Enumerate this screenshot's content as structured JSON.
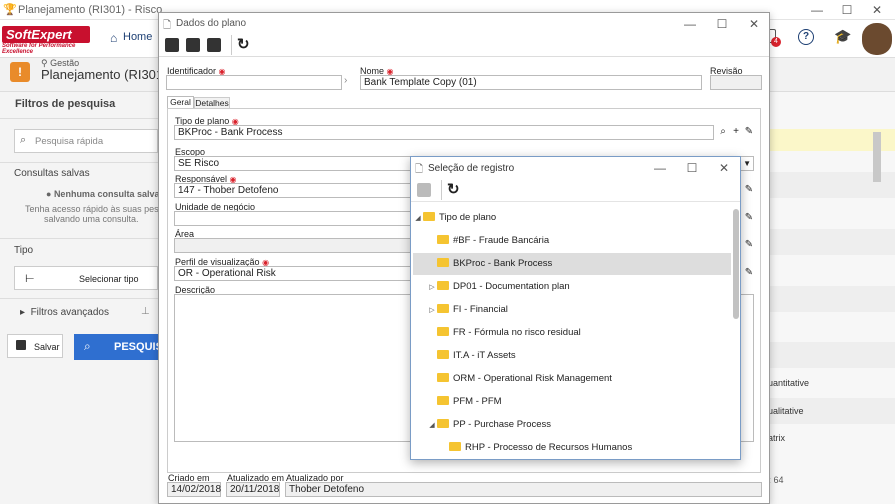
{
  "window": {
    "title": "Planejamento (RI301) - Risco"
  },
  "topnav": {
    "logo_main": "SoftExpert",
    "logo_tagline": "Software for Performance Excellence",
    "home": "Home",
    "badge": "4"
  },
  "header": {
    "breadcrumb": "Gestão",
    "title": "Planejamento (RI301)"
  },
  "left": {
    "filters_title": "Filtros de pesquisa",
    "quick_search_placeholder": "Pesquisa rápida",
    "saved_title": "Consultas salvas",
    "no_saved": "Nenhuma consulta salva.",
    "saved_hint_1": "Tenha acesso rápido às suas pesqu",
    "saved_hint_2": "salvando uma consulta.",
    "type_title": "Tipo",
    "select_type": "Selecionar tipo",
    "advanced": "Filtros avançados",
    "save": "Salvar",
    "search": "PESQUISA"
  },
  "right": {
    "row1": "uantitative",
    "row2": "ualitative",
    "row3": "atrix",
    "pager": "s: 64"
  },
  "dialog": {
    "title": "Dados do plano",
    "identifier_label": "Identificador",
    "name_label": "Nome",
    "name_value": "Bank Template Copy (01)",
    "revision_label": "Revisão",
    "tabs": [
      "Geral",
      "Detalhes"
    ],
    "plan_type_label": "Tipo de plano",
    "plan_type_value": "BKProc - Bank Process",
    "scope_label": "Escopo",
    "scope_value": "SE Risco",
    "responsible_label": "Responsável",
    "responsible_value": "147 - Thober Detofeno",
    "business_unit_label": "Unidade de negócio",
    "area_label": "Área",
    "view_profile_label": "Perfil de visualização",
    "view_profile_value": "OR - Operational Risk",
    "description_label": "Descrição",
    "created_label": "Criado em",
    "created_value": "14/02/2018",
    "updated_label": "Atualizado em",
    "updated_value": "20/11/2018",
    "updated_by_label": "Atualizado por",
    "updated_by_value": "Thober Detofeno"
  },
  "popup": {
    "title": "Seleção de registro",
    "root": "Tipo de plano",
    "items": [
      "#BF - Fraude Bancária",
      "BKProc - Bank Process",
      "DP01 - Documentation plan",
      "FI - Financial",
      "FR - Fórmula no risco residual",
      "IT.A - iT Assets",
      "ORM - Operational Risk Management",
      "PFM - PFM",
      "PP - Purchase Process",
      "RHP - Processo de Recursos Humanos"
    ]
  }
}
